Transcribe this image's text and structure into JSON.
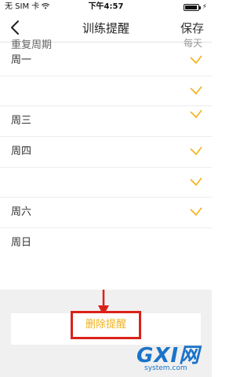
{
  "status_bar": {
    "carrier": "无 SIM 卡",
    "time": "下午4:57",
    "charging_icon": "charging-icon"
  },
  "nav": {
    "title": "训练提醒",
    "save_label": "保存"
  },
  "repeat_row": {
    "label": "重复周期",
    "value": "每天"
  },
  "days": [
    {
      "label": "周一",
      "checked": true
    },
    {
      "label": "",
      "checked": true
    },
    {
      "label": "周三",
      "checked": true
    },
    {
      "label": "周四",
      "checked": true
    },
    {
      "label": "",
      "checked": true
    },
    {
      "label": "周六",
      "checked": true
    },
    {
      "label": "周日",
      "checked": false
    }
  ],
  "delete_label": "删除提醒",
  "watermark": {
    "brand": "GXI网",
    "site": "system.com"
  },
  "colors": {
    "accent": "#f2b21b",
    "highlight_box": "#d9221a",
    "arrow": "#d9221a"
  }
}
